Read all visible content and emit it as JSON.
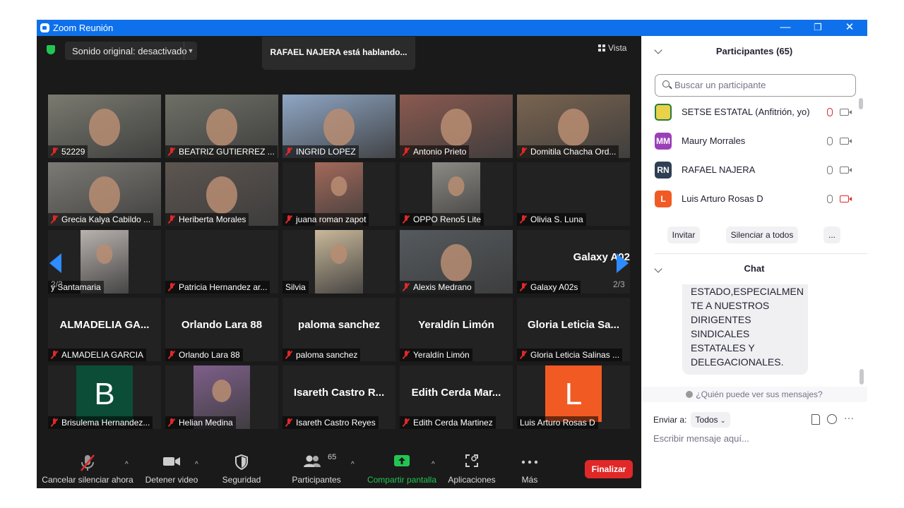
{
  "window": {
    "title": "Zoom Reunión",
    "minimize": "—",
    "restore": "❐",
    "close": "✕"
  },
  "topbar": {
    "sound_original": "Sonido original: desactivado",
    "speaking": "RAFAEL NAJERA está hablando...",
    "view": "Vista"
  },
  "pagination": {
    "left": "2/3",
    "right": "2/3"
  },
  "tiles": [
    {
      "name": "52229",
      "muted": true,
      "big": "",
      "video_color": "#7a7a70"
    },
    {
      "name": "BEATRIZ GUTIERREZ ...",
      "muted": true,
      "big": "",
      "video_color": "#6e7066"
    },
    {
      "name": "INGRID LOPEZ",
      "muted": true,
      "big": "",
      "video_color": "#8fa6c4"
    },
    {
      "name": "Antonio Prieto",
      "muted": true,
      "big": "",
      "video_color": "#8a5a50"
    },
    {
      "name": "Domitila Chacha Ord...",
      "muted": true,
      "big": "",
      "video_color": "#7a6450"
    },
    {
      "name": "Grecia Kalya Cabildo ...",
      "muted": true,
      "big": "",
      "video_color": "#7c7a74"
    },
    {
      "name": "Heriberta Morales",
      "muted": true,
      "big": "",
      "video_color": "#5d5550"
    },
    {
      "name": "juana roman zapot",
      "muted": true,
      "big": "",
      "video_color": "#a3695a"
    },
    {
      "name": "OPPO Reno5 Lite",
      "muted": true,
      "big": "",
      "video_color": "#8c8a84"
    },
    {
      "name": "Olivia S. Luna",
      "muted": true,
      "big": "",
      "video_color": ""
    },
    {
      "name": "y Santamaria",
      "muted": false,
      "big": "",
      "video_color": "#b8b2ae"
    },
    {
      "name": "Patricia Hernandez ar...",
      "muted": true,
      "big": "",
      "video_color": ""
    },
    {
      "name": "Silvia",
      "muted": false,
      "big": "",
      "video_color": "#c9b89a"
    },
    {
      "name": "Alexis Medrano",
      "muted": true,
      "big": "",
      "video_color": "#555a5e"
    },
    {
      "name": "Galaxy A02s",
      "muted": true,
      "big": "Galaxy A02",
      "video_color": ""
    },
    {
      "name": "ALMADELIA GARCIA",
      "muted": true,
      "big": "ALMADELIA GA...",
      "video_color": ""
    },
    {
      "name": "Orlando Lara 88",
      "muted": true,
      "big": "Orlando Lara 88",
      "video_color": ""
    },
    {
      "name": "paloma sanchez",
      "muted": true,
      "big": "paloma sanchez",
      "video_color": ""
    },
    {
      "name": "Yeraldín Limón",
      "muted": true,
      "big": "Yeraldín Limón",
      "video_color": ""
    },
    {
      "name": "Gloria Leticia Salinas ...",
      "muted": true,
      "big": "Gloria Leticia Sa...",
      "video_color": ""
    },
    {
      "name": "Brisulema Hernandez...",
      "muted": true,
      "big": "",
      "avatar": "B",
      "avatar_color": "#0c4d38",
      "video_color": ""
    },
    {
      "name": "Helian Medina",
      "muted": true,
      "big": "",
      "video_color": "#7e5f8a"
    },
    {
      "name": "Isareth Castro Reyes",
      "muted": true,
      "big": "Isareth Castro R...",
      "video_color": ""
    },
    {
      "name": "Edith Cerda Martinez",
      "muted": true,
      "big": "Edith Cerda Mar...",
      "video_color": ""
    },
    {
      "name": "Luis Arturo Rosas D",
      "muted": false,
      "big": "",
      "avatar": "L",
      "avatar_color": "#f25a24",
      "video_color": ""
    }
  ],
  "toolbar": {
    "mute": "Cancelar silenciar ahora",
    "video": "Detener video",
    "security": "Seguridad",
    "participants": "Participantes",
    "participants_count": "65",
    "share": "Compartir pantalla",
    "apps": "Aplicaciones",
    "more": "Más",
    "end": "Finalizar"
  },
  "participants_panel": {
    "title": "Participantes (65)",
    "search_placeholder": "Buscar un participante",
    "list": [
      {
        "name": "SETSE ESTATAL (Anfitrión, yo)",
        "initials": "",
        "color": "#e8d24a",
        "mic_muted": true,
        "cam_off": false
      },
      {
        "name": "Maury Morrales",
        "initials": "MM",
        "color": "#9b3fb8",
        "mic_muted": false,
        "cam_off": false
      },
      {
        "name": "RAFAEL NAJERA",
        "initials": "RN",
        "color": "#2f3f54",
        "mic_muted": false,
        "cam_off": false
      },
      {
        "name": "Luis Arturo Rosas D",
        "initials": "L",
        "color": "#f25a24",
        "mic_muted": false,
        "cam_off": true
      }
    ],
    "invite": "Invitar",
    "mute_all": "Silenciar a todos",
    "more": "..."
  },
  "chat_panel": {
    "title": "Chat",
    "message_text": "ESTADO,ESPECIALMENTE A NUESTROS DIRIGENTES SINDICALES ESTATALES Y DELEGACIONALES.",
    "message_lines": [
      "ESTADO,ESPECIALMEN",
      "TE A NUESTROS",
      "DIRIGENTES",
      "SINDICALES",
      "ESTATALES Y",
      "DELEGACIONALES."
    ],
    "who_can_see": "¿Quién puede ver sus mensajes?",
    "send_to_label": "Enviar a:",
    "send_to_value": "Todos",
    "composer_placeholder": "Escribir mensaje aquí..."
  }
}
